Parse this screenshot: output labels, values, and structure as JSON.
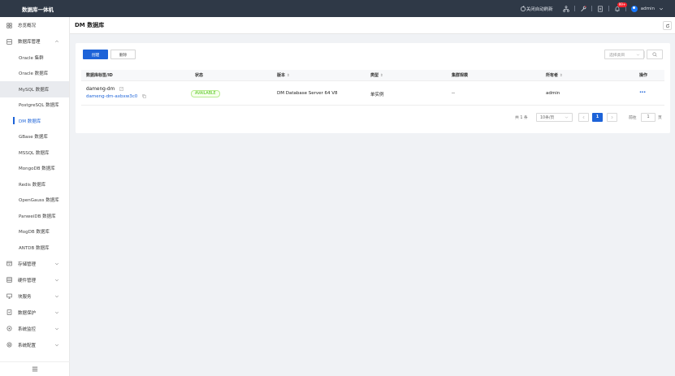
{
  "app": {
    "title": "数据库一体机"
  },
  "topbar": {
    "auto_refresh": "关闭自动刷新",
    "notification_count": "99+",
    "user": "admin"
  },
  "sidebar": {
    "overview": "总览概况",
    "db_mgmt": "数据库管理",
    "db_items": [
      "Oracle 集群",
      "Oracle 数据库",
      "MySQL 数据库",
      "PostgreSQL 数据库",
      "DM 数据库",
      "GBase 数据库",
      "MSSQL 数据库",
      "MongoDB 数据库",
      "Redis 数据库",
      "OpenGauss 数据库",
      "PanweiDB 数据库",
      "MogDB 数据库",
      "ANTDB 数据库"
    ],
    "groups": [
      "存储管理",
      "硬件管理",
      "块服务",
      "数据保护",
      "系统监控",
      "系统配置"
    ]
  },
  "page": {
    "title": "DM 数据库"
  },
  "toolbar": {
    "create_label": "创建",
    "delete_label": "删除",
    "filter_placeholder": "选择类目"
  },
  "table": {
    "headers": [
      "数据库标签/ID",
      "状态",
      "版本",
      "类型",
      "集群规模",
      "所有者",
      "操作"
    ],
    "rows": [
      {
        "name": "dameng-dm",
        "id": "dameng-dm-axbxw3c0",
        "status": "AVAILABLE",
        "version": "DM Database Server 64 V8",
        "type": "单实例",
        "scale": "--",
        "owner": "admin"
      }
    ]
  },
  "pagination": {
    "total": "共 1 条",
    "page_size": "10条/页",
    "current": "1",
    "goto_prefix": "前往",
    "goto_value": "1",
    "goto_suffix": "页"
  },
  "colors": {
    "primary": "#1d63d8",
    "topbar": "#2f3947",
    "success": "#52c41a"
  }
}
